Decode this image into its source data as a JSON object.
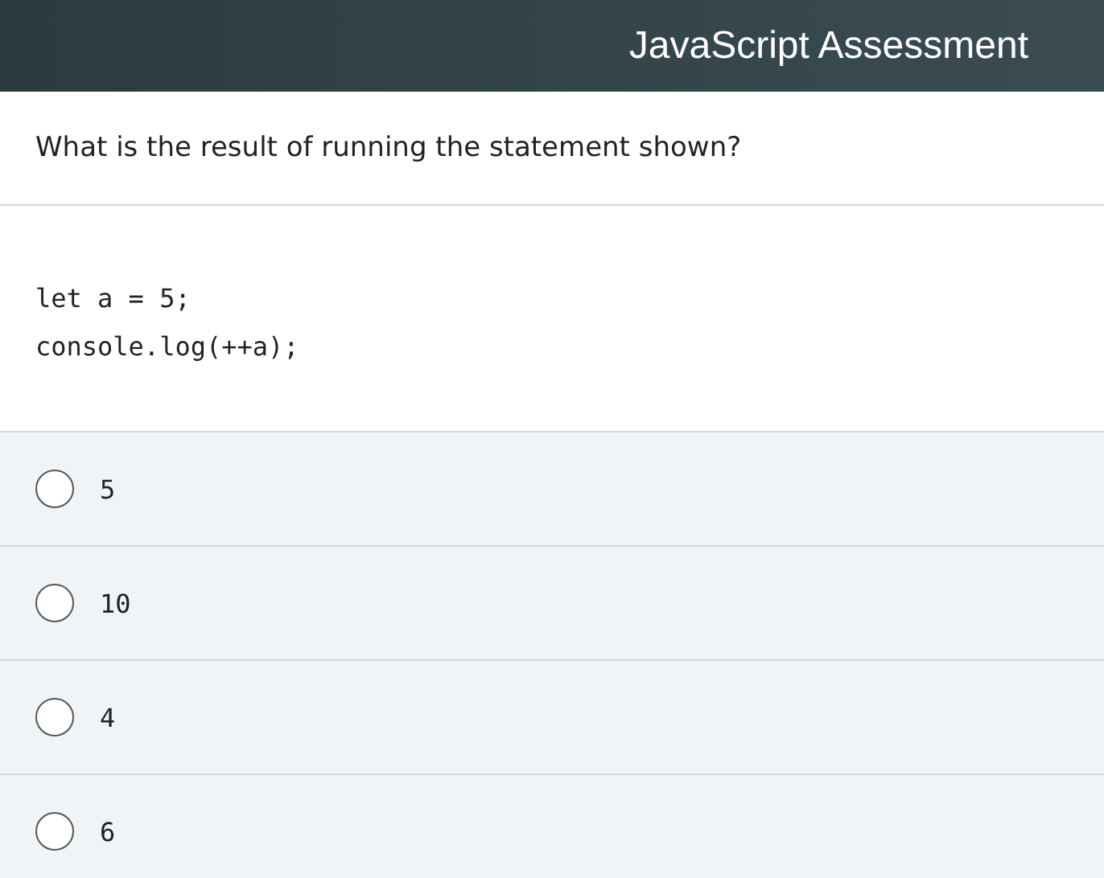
{
  "header": {
    "title": "JavaScript Assessment"
  },
  "question": "What is the result of running the statement shown?",
  "code": [
    "let a = 5;",
    "console.log(++a);"
  ],
  "options": [
    {
      "label": "5",
      "selected": false
    },
    {
      "label": "10",
      "selected": false
    },
    {
      "label": "4",
      "selected": false
    },
    {
      "label": "6",
      "selected": false
    }
  ]
}
